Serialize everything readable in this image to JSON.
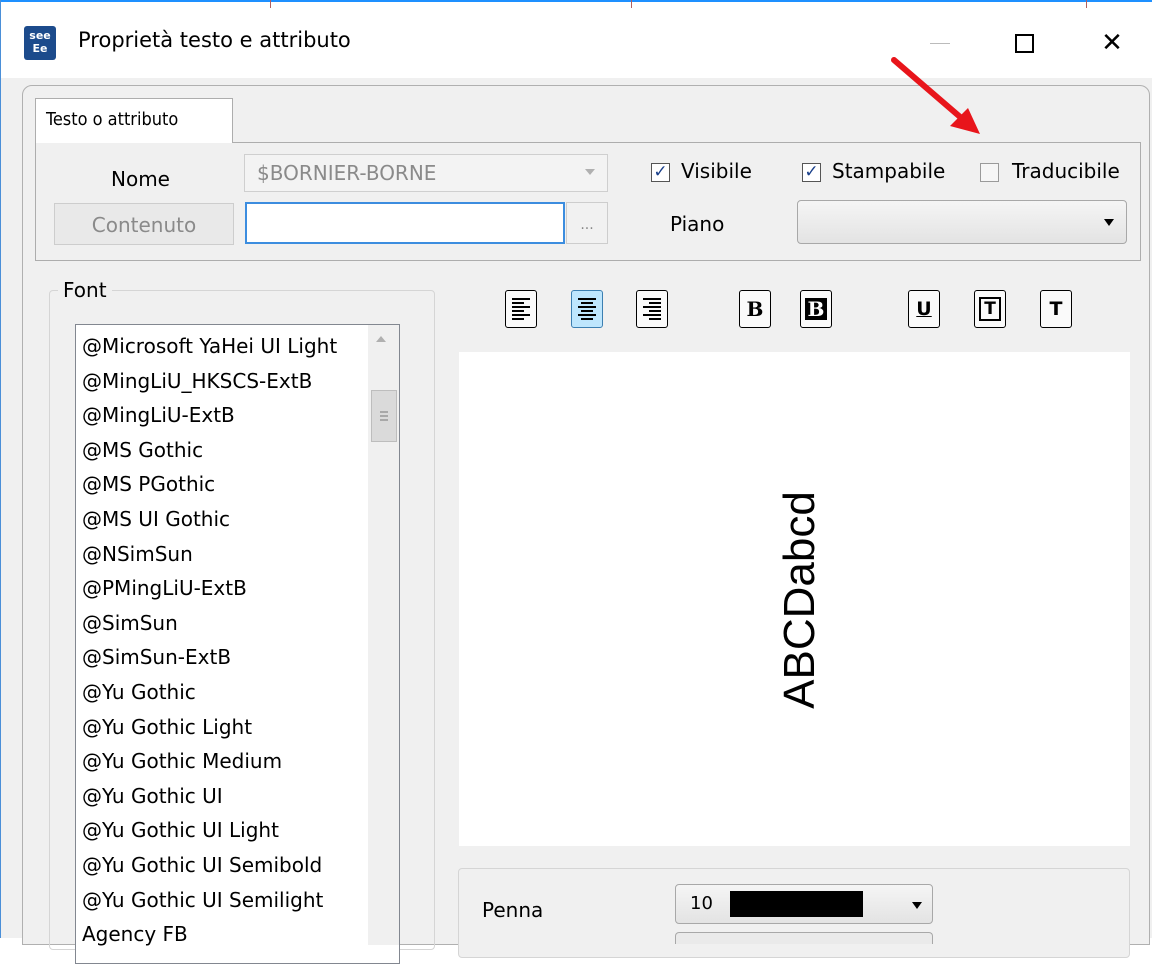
{
  "window": {
    "icon_text": "see Ee",
    "title": "Proprietà testo e attributo",
    "close_glyph": "✕"
  },
  "tab": {
    "label": "Testo o attributo"
  },
  "form": {
    "name_label": "Nome",
    "name_value": "$BORNIER-BORNE",
    "content_button": "Contenuto",
    "content_value": "",
    "ellipsis_label": "...",
    "visible_label": "Visibile",
    "visible_checked": true,
    "printable_label": "Stampabile",
    "printable_checked": true,
    "translatable_label": "Traducibile",
    "translatable_checked": false,
    "piano_label": "Piano",
    "piano_value": "",
    "check_glyph": "✓"
  },
  "font_group": {
    "label": "Font",
    "items": [
      "@Microsoft YaHei UI Light",
      "@MingLiU_HKSCS-ExtB",
      "@MingLiU-ExtB",
      "@MS Gothic",
      "@MS PGothic",
      "@MS UI Gothic",
      "@NSimSun",
      "@PMingLiU-ExtB",
      "@SimSun",
      "@SimSun-ExtB",
      "@Yu Gothic",
      "@Yu Gothic Light",
      "@Yu Gothic Medium",
      "@Yu Gothic UI",
      "@Yu Gothic UI Light",
      "@Yu Gothic UI Semibold",
      "@Yu Gothic UI Semilight",
      "Agency FB"
    ]
  },
  "toolbar": {
    "bold_letter": "B",
    "bold_inverse_letter": "B",
    "underline_letter": "U",
    "boxed_letter": "T",
    "plain_letter": "T"
  },
  "preview": {
    "text": "ABCDabcd"
  },
  "pen": {
    "label": "Penna",
    "value": "10",
    "color": "#000000"
  },
  "colors": {
    "accent": "#3c8ddf",
    "active_button": "#bee6fd",
    "annotation_arrow": "#e8151b"
  }
}
